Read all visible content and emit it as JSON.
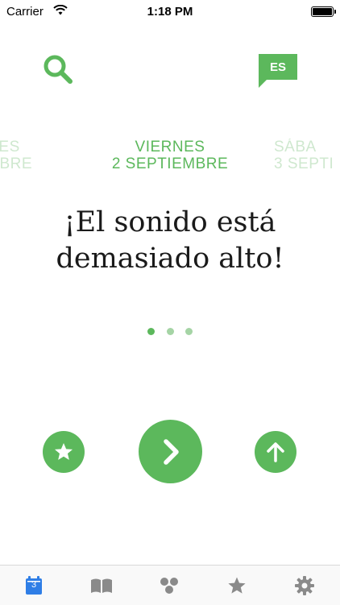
{
  "status_bar": {
    "carrier": "Carrier",
    "time": "1:18 PM",
    "battery_level": 1.0
  },
  "header": {
    "search_icon": "search-icon",
    "language": "ES"
  },
  "dates": {
    "previous": {
      "line1": "VES",
      "line2": "EMBRE"
    },
    "current": {
      "line1": "VIERNES",
      "line2": "2 SEPTIEMBRE"
    },
    "next": {
      "line1": "SÁBA",
      "line2": "3 SEPTI"
    }
  },
  "phrase": "¡El sonido está demasiado alto!",
  "pager": {
    "count": 3,
    "active": 1
  },
  "actions": {
    "favorite_icon": "star-icon",
    "next_icon": "chevron-right-icon",
    "up_icon": "arrow-up-icon"
  },
  "tab_bar": {
    "calendar_day": "3",
    "tabs": [
      "calendar-icon",
      "book-icon",
      "dots-icon",
      "star-icon",
      "gear-icon"
    ],
    "active_color": "#2f7ee6",
    "inactive_color": "#8a8a8a"
  },
  "colors": {
    "accent": "#5cb85c",
    "accent_light": "#cfe8cf"
  }
}
